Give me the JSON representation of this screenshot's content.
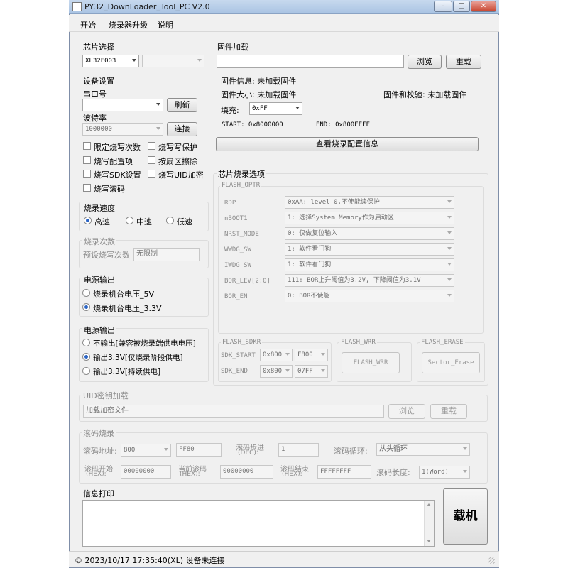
{
  "window": {
    "title": "PY32_DownLoader_Tool_PC V2.0",
    "min": "–",
    "max": "□",
    "close": "✕"
  },
  "menu": [
    "开始",
    "烧录器升级",
    "说明"
  ],
  "chip_select": {
    "title": "芯片选择",
    "chip": "XL32F003",
    "sub": ""
  },
  "device": {
    "title": "设备设置",
    "port_label": "串口号",
    "port_value": "",
    "refresh": "刷新",
    "baud_label": "波特率",
    "baud_value": "1000000",
    "connect": "连接",
    "checks": [
      "限定烧写次数",
      "烧写写保护",
      "烧写配置项",
      "按扇区擦除",
      "烧写SDK设置",
      "烧写UID加密",
      "烧写滚码"
    ]
  },
  "speed": {
    "title": "烧录速度",
    "options": [
      "高速",
      "中速",
      "低速"
    ],
    "selected": 0
  },
  "count": {
    "title": "烧录次数",
    "label": "预设烧写次数",
    "value": "无限制"
  },
  "power_in": {
    "title": "电源输出",
    "options": [
      "烧录机台电压_5V",
      "烧录机台电压_3.3V"
    ],
    "selected": 1
  },
  "power_out": {
    "title": "电源输出",
    "options": [
      "不输出[兼容被烧录端供电电压]",
      "输出3.3V[仅烧录阶段供电]",
      "输出3.3V[持续供电]"
    ],
    "selected": 1
  },
  "firmware": {
    "title": "固件加载",
    "path": "",
    "browse": "浏览",
    "reload": "重载",
    "info": "固件信息: 未加载固件",
    "size": "固件大小: 未加载固件",
    "checksum": "固件和校验: 未加载固件",
    "fill_label": "填充:",
    "fill_value": "0xFF",
    "start": "START:  0x8000000",
    "end": "END:  0x800FFFF",
    "view_btn": "查看烧录配置信息"
  },
  "options": {
    "title": "芯片烧录选项",
    "optr_title": "FLASH_OPTR",
    "rows": [
      {
        "label": "RDP",
        "value": "0xAA: level 0,不使能读保护"
      },
      {
        "label": "nBOOT1",
        "value": "1: 选择System Memory作为启动区"
      },
      {
        "label": "NRST_MODE",
        "value": "0: 仅做复位输入"
      },
      {
        "label": "WWDG_SW",
        "value": "1: 软件看门狗"
      },
      {
        "label": "IWDG_SW",
        "value": "1: 软件看门狗"
      },
      {
        "label": "BOR_LEV[2:0]",
        "value": "111: BOR上升阈值为3.2V, 下降阈值为3.1V"
      },
      {
        "label": "BOR_EN",
        "value": "0: BOR不使能"
      }
    ],
    "sdkr_title": "FLASH_SDKR",
    "sdk_start_label": "SDK_START",
    "sdk_start_a": "0x800",
    "sdk_start_b": "F800",
    "sdk_end_label": "SDK_END",
    "sdk_end_a": "0x800",
    "sdk_end_b": "07FF",
    "wrr_title": "FLASH_WRR",
    "wrr_btn": "FLASH_WRR",
    "erase_title": "FLASH_ERASE",
    "erase_btn": "Sector_Erase"
  },
  "uid": {
    "title": "UID密钥加载",
    "path": "加载加密文件",
    "browse": "浏览",
    "reload": "重载"
  },
  "rolling": {
    "title": "滚码烧录",
    "addr_label": "滚码地址:",
    "addr_value": "800",
    "addr_hex": "FF80",
    "step_label_1": "滚码步进",
    "step_label_2": "(DEC):",
    "step_value": "1",
    "loop_label": "滚码循环:",
    "loop_value": "从头循环",
    "start_label_1": "滚码开始",
    "start_label_2": "(HEX):",
    "start_value": "00000000",
    "cur_label_1": "当前滚码",
    "cur_label_2": "(HEX):",
    "cur_value": "00000000",
    "end_label_1": "滚码结束",
    "end_label_2": "(HEX):",
    "end_value": "FFFFFFFF",
    "len_label": "滚码长度:",
    "len_value": "1(Word)"
  },
  "log": {
    "title": "信息打印",
    "content": ""
  },
  "load_button": "载机",
  "status": {
    "text": "©  2023/10/17 17:35:40(XL)   设备未连接"
  }
}
